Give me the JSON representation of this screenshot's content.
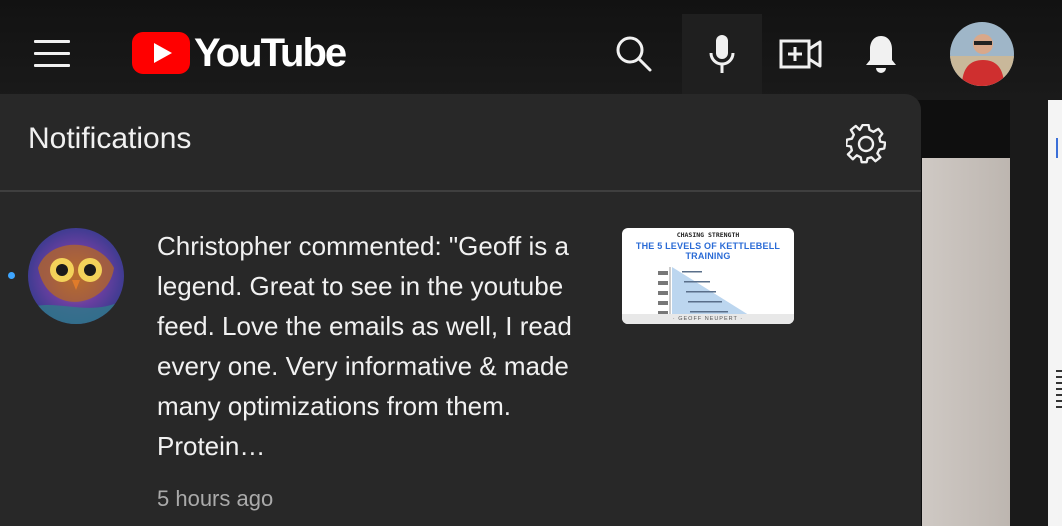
{
  "masthead": {
    "logo_text": "YouTube",
    "icons": {
      "menu": "hamburger-menu-icon",
      "search": "search-icon",
      "mic": "microphone-icon",
      "create": "create-video-icon",
      "notifications": "bell-icon",
      "account": "avatar"
    },
    "brand_color": "#ff0000"
  },
  "notifications_panel": {
    "title": "Notifications",
    "settings_icon": "gear-icon",
    "items": [
      {
        "text": "Christopher commented: \"Geoff is a legend. Great to see in the youtube feed. Love the emails as well, I read every one. Very informative & made many optimizations from them. Protein…",
        "time": "5 hours ago",
        "unread": true,
        "thumbnail": {
          "heading": "CHASING STRENGTH",
          "title": "THE 5 LEVELS OF KETTLEBELL TRAINING",
          "footer": "· GEOFF NEUPERT ·"
        }
      }
    ]
  },
  "colors": {
    "panel_bg": "#282828",
    "unread_dot": "#3ea6ff",
    "time_text": "#aaaaaa"
  }
}
